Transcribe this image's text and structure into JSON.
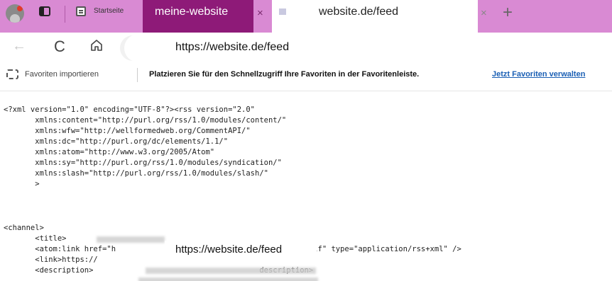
{
  "tabs": {
    "startseite": "Startseite",
    "site": "meine-website",
    "active": "website.de/feed",
    "close_glyph": "×",
    "new_glyph": "+"
  },
  "toolbar": {
    "back_glyph": "←",
    "reload_glyph": "C",
    "url": "https://website.de/feed"
  },
  "favorites": {
    "import_label": "Favoriten importieren",
    "hint": "Platzieren Sie für den Schnellzugriff Ihre Favoriten in der Favoritenleiste.",
    "manage_link": "Jetzt Favoriten verwalten"
  },
  "content": {
    "xml_header": "<?xml version=\"1.0\" encoding=\"UTF-8\"?><rss version=\"2.0\"\n       xmlns:content=\"http://purl.org/rss/1.0/modules/content/\"\n       xmlns:wfw=\"http://wellformedweb.org/CommentAPI/\"\n       xmlns:dc=\"http://purl.org/dc/elements/1.1/\"\n       xmlns:atom=\"http://www.w3.org/2005/Atom\"\n       xmlns:sy=\"http://purl.org/rss/1.0/modules/syndication/\"\n       xmlns:slash=\"http://purl.org/rss/1.0/modules/slash/\"\n       >",
    "xml_channel": "<channel>\n       <title>\n       <atom:link href=\"h                                 d/\" rel=\"self\" type=\"application/rss+xml\" />\n       <link>https://\n       <description>                                     description>",
    "overlay_url": "https://website.de/feed"
  },
  "colors": {
    "tabbar": "#d98ad3",
    "site_tab": "#8e1a78",
    "link": "#1a5fb4"
  },
  "icons": [
    "profile-avatar-icon",
    "tab-actions-icon",
    "page-icon",
    "lock-icon",
    "home-icon",
    "favorites-import-icon"
  ]
}
